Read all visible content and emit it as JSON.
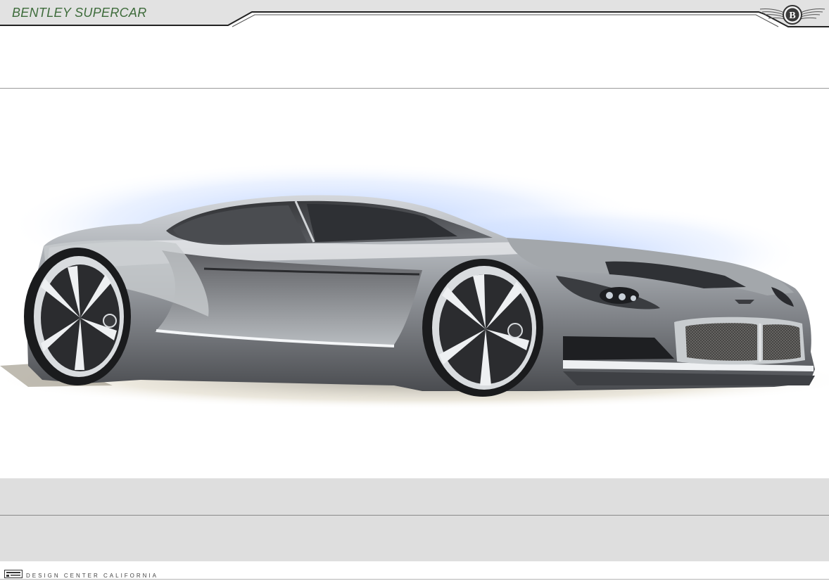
{
  "header": {
    "title": "BENTLEY SUPERCAR",
    "logo_icon": "bentley-winged-b-icon"
  },
  "sketch": {
    "subject": "concept-car-sketch"
  },
  "footer": {
    "studio": "DESIGN  CENTER  CALIFORNIA",
    "mark_icon": "studio-mark-icon"
  },
  "colors": {
    "title_green": "#3d6b3a",
    "band_gray": "#dedede",
    "glow_blue": "#a9c6ff",
    "body_silver": "#9ea3a8"
  }
}
